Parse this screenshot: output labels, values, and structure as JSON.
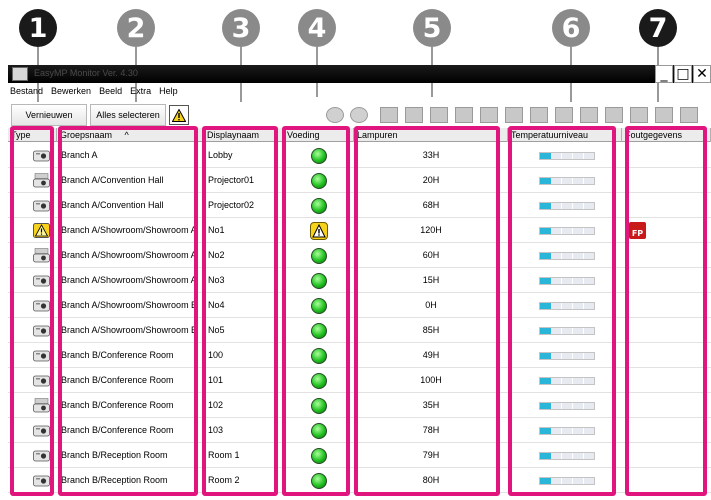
{
  "app": {
    "title": "EasyMP Monitor Ver. 4.30",
    "window_buttons": [
      "_",
      "□",
      "✕"
    ]
  },
  "menu": [
    "Bestand",
    "Bewerken",
    "Beeld",
    "Extra",
    "Help"
  ],
  "toolbar": {
    "refresh_label": "Vernieuwen",
    "select_all_label": "Alles selecteren"
  },
  "callouts": [
    "1",
    "2",
    "3",
    "4",
    "5",
    "6",
    "7"
  ],
  "columns": {
    "type": "Type",
    "group": "Groepsnaam",
    "group_sort": "^",
    "display": "Displaynaam",
    "power": "Voeding",
    "lamp": "Lampuren",
    "temp": "Temperatuurniveau",
    "error": "Foutgegevens"
  },
  "rows": [
    {
      "group": "Branch A",
      "display": "Lobby",
      "lamp": "33H",
      "type_icon": "projector-icon",
      "status": "on",
      "temp_level": 0.2,
      "error": ""
    },
    {
      "group": "Branch A/Convention Hall",
      "display": "Projector01",
      "lamp": "20H",
      "type_icon": "projector-network-icon",
      "status": "on",
      "temp_level": 0.2,
      "error": ""
    },
    {
      "group": "Branch A/Convention Hall",
      "display": "Projector02",
      "lamp": "68H",
      "type_icon": "projector-icon",
      "status": "on",
      "temp_level": 0.2,
      "error": ""
    },
    {
      "group": "Branch A/Showroom/Showroom A",
      "display": "No1",
      "lamp": "120H",
      "type_icon": "warning-icon",
      "status": "warning",
      "temp_level": 0.2,
      "error": "FP"
    },
    {
      "group": "Branch A/Showroom/Showroom A",
      "display": "No2",
      "lamp": "60H",
      "type_icon": "projector-network-icon",
      "status": "on",
      "temp_level": 0.2,
      "error": ""
    },
    {
      "group": "Branch A/Showroom/Showroom A",
      "display": "No3",
      "lamp": "15H",
      "type_icon": "projector-icon",
      "status": "on",
      "temp_level": 0.2,
      "error": ""
    },
    {
      "group": "Branch A/Showroom/Showroom B",
      "display": "No4",
      "lamp": "0H",
      "type_icon": "projector-icon",
      "status": "on",
      "temp_level": 0.2,
      "error": ""
    },
    {
      "group": "Branch A/Showroom/Showroom B",
      "display": "No5",
      "lamp": "85H",
      "type_icon": "projector-icon",
      "status": "on",
      "temp_level": 0.2,
      "error": ""
    },
    {
      "group": "Branch B/Conference Room",
      "display": "100",
      "lamp": "49H",
      "type_icon": "projector-icon",
      "status": "on",
      "temp_level": 0.2,
      "error": ""
    },
    {
      "group": "Branch B/Conference Room",
      "display": "101",
      "lamp": "100H",
      "type_icon": "projector-icon",
      "status": "on",
      "temp_level": 0.2,
      "error": ""
    },
    {
      "group": "Branch B/Conference Room",
      "display": "102",
      "lamp": "35H",
      "type_icon": "projector-network-icon",
      "status": "on",
      "temp_level": 0.2,
      "error": ""
    },
    {
      "group": "Branch B/Conference Room",
      "display": "103",
      "lamp": "78H",
      "type_icon": "projector-icon",
      "status": "on",
      "temp_level": 0.2,
      "error": ""
    },
    {
      "group": "Branch B/Reception Room",
      "display": "Room 1",
      "lamp": "79H",
      "type_icon": "projector-icon",
      "status": "on",
      "temp_level": 0.2,
      "error": ""
    },
    {
      "group": "Branch B/Reception Room",
      "display": "Room 2",
      "lamp": "80H",
      "type_icon": "projector-icon",
      "status": "on",
      "temp_level": 0.2,
      "error": ""
    }
  ],
  "colors": {
    "highlight": "#e0167e",
    "status_ok": "#20c020",
    "temp_fill": "#2ab6d8",
    "error_badge": "#c91a1a"
  }
}
